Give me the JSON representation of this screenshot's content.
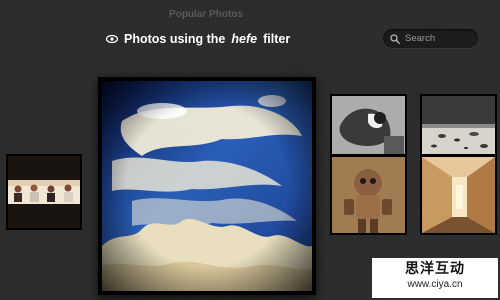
{
  "page": {
    "title": "Popular Photos"
  },
  "header": {
    "prefix": "Photos using the",
    "filter_name": "hefe",
    "suffix": "filter",
    "icon": "eye-icon"
  },
  "search": {
    "placeholder": "Search",
    "icon": "search-icon"
  },
  "photos": [
    {
      "name": "sky-clouds-photo",
      "description_icon": "photo"
    },
    {
      "name": "group-people-photo",
      "description_icon": "photo"
    },
    {
      "name": "bw-figure-photo",
      "description_icon": "photo"
    },
    {
      "name": "beach-rocks-photo",
      "description_icon": "photo"
    },
    {
      "name": "robot-toy-photo",
      "description_icon": "photo"
    },
    {
      "name": "corridor-photo",
      "description_icon": "photo"
    }
  ],
  "watermark": {
    "title": "思洋互动",
    "url": "www.ciya.cn"
  },
  "colors": {
    "background": "#2c2c2c",
    "header_text": "#ffffff",
    "title_text": "#5a5a5a"
  }
}
